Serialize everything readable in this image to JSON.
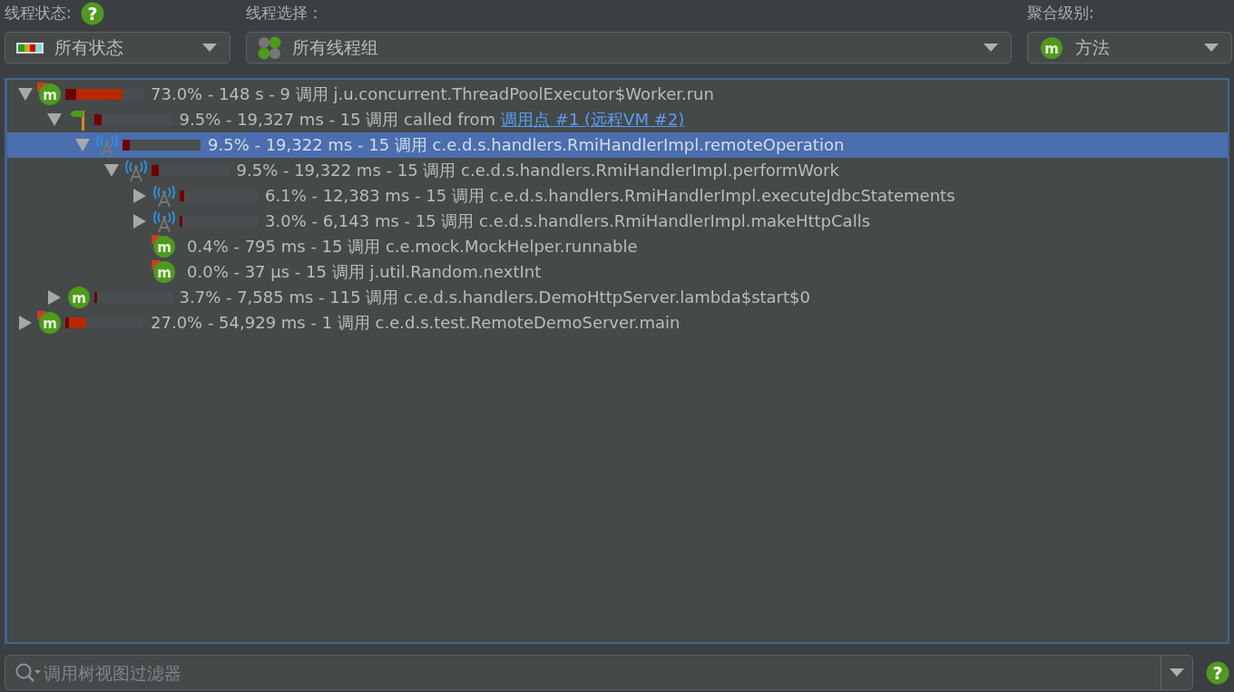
{
  "header": {
    "thread_status_label": "线程状态:",
    "help_icon": "?",
    "thread_status": "所有状态",
    "thread_select_label": "线程选择：",
    "thread_select": "所有线程组",
    "aggregation_label": "聚合级别:",
    "aggregation_icon": "m",
    "aggregation": "方法"
  },
  "tree": [
    {
      "kind": "method_marked",
      "icon_text": "m",
      "text": "73.0% - 148 s - 9 调用 j.u.concurrent.ThreadPoolExecutor$Worker.run",
      "level": 0.73,
      "expanded": true,
      "selected": false,
      "children": [
        {
          "kind": "callsite",
          "text": "9.5% - 19,327 ms - 15 调用 called from",
          "link": "调用点 #1 (远程VM #2)",
          "level": 0.095,
          "expanded": true,
          "selected": false,
          "children": [
            {
              "kind": "remote",
              "text": "9.5% - 19,322 ms - 15 调用 c.e.d.s.handlers.RmiHandlerImpl.remoteOperation",
              "level": 0.095,
              "expanded": true,
              "selected": true,
              "children": [
                {
                  "kind": "remote",
                  "text": "9.5% - 19,322 ms - 15 调用 c.e.d.s.handlers.RmiHandlerImpl.performWork",
                  "level": 0.095,
                  "expanded": true,
                  "selected": false,
                  "children": [
                    {
                      "kind": "remote",
                      "text": "6.1% - 12,383 ms - 15 调用 c.e.d.s.handlers.RmiHandlerImpl.executeJdbcStatements",
                      "level": 0.061,
                      "expanded": false,
                      "selected": false
                    },
                    {
                      "kind": "remote",
                      "text": "3.0% - 6,143 ms - 15 调用 c.e.d.s.handlers.RmiHandlerImpl.makeHttpCalls",
                      "level": 0.03,
                      "expanded": false,
                      "selected": false
                    },
                    {
                      "kind": "method_marked",
                      "icon_text": "m",
                      "text": "0.4% - 795 ms - 15 调用 c.e.mock.MockHelper.runnable",
                      "selected": false
                    },
                    {
                      "kind": "method_marked",
                      "icon_text": "m",
                      "text": "0.0% - 37 µs - 15 调用 j.util.Random.nextInt",
                      "selected": false
                    }
                  ]
                }
              ]
            }
          ]
        },
        {
          "kind": "method",
          "icon_text": "m",
          "text": "3.7% - 7,585 ms - 115 调用 c.e.d.s.handlers.DemoHttpServer.lambda$start$0",
          "level": 0.037,
          "expanded": false,
          "selected": false
        }
      ]
    },
    {
      "kind": "method_marked",
      "icon_text": "m",
      "text": "27.0% - 54,929 ms - 1 调用 c.e.d.s.test.RemoteDemoServer.main",
      "level": 0.27,
      "expanded": false,
      "selected": false
    }
  ],
  "filter": {
    "placeholder": "调用树视图过滤器",
    "help_icon": "?"
  }
}
